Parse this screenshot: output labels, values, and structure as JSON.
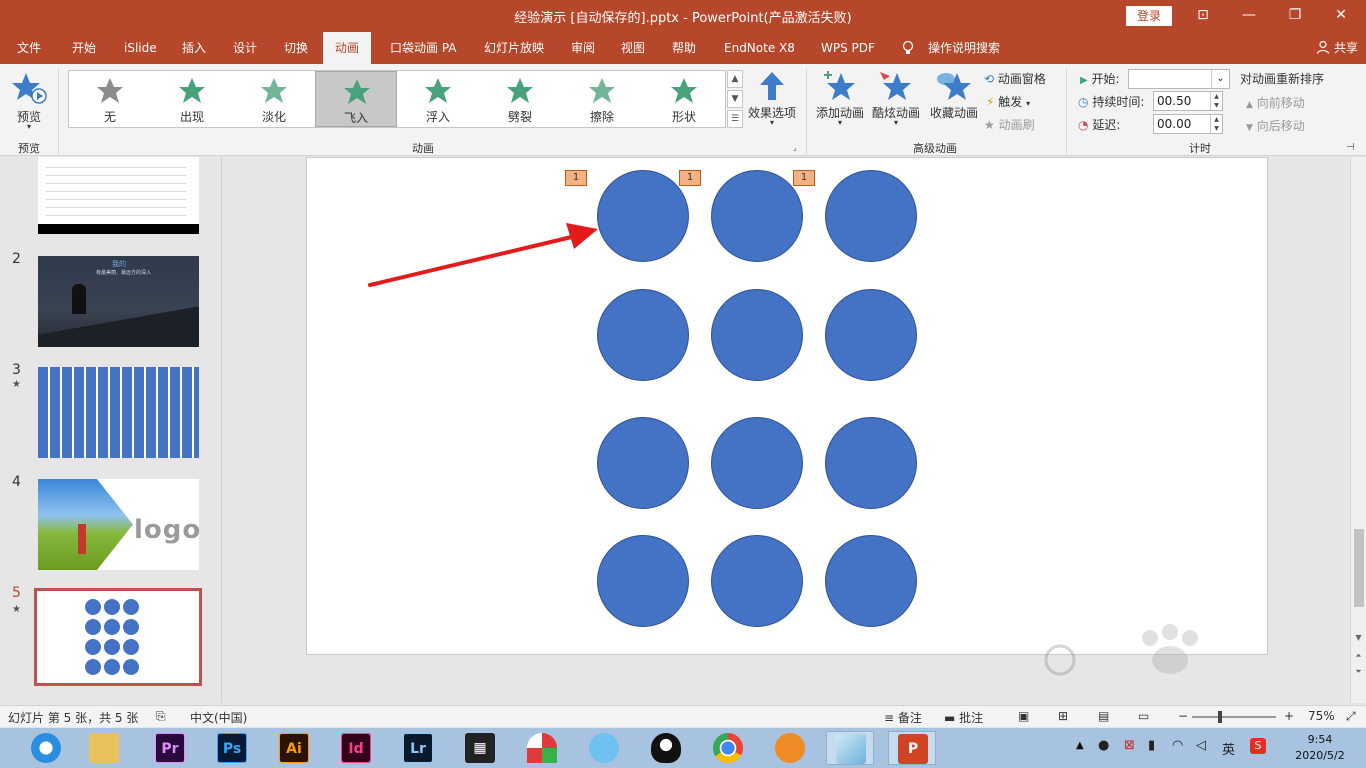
{
  "titlebar": {
    "title": "经验演示 [自动保存的].pptx  -  PowerPoint(产品激活失败)",
    "login": "登录",
    "ribbon_display_icon": "⊡",
    "minimize_icon": "—",
    "restore_icon": "❐",
    "close_icon": "✕"
  },
  "tabs": [
    "文件",
    "开始",
    "iSlide",
    "插入",
    "设计",
    "切换",
    "动画",
    "口袋动画 PA",
    "幻灯片放映",
    "审阅",
    "视图",
    "帮助",
    "EndNote X8",
    "WPS PDF",
    "操作说明搜索"
  ],
  "share": "共享",
  "ribbon": {
    "preview": {
      "label": "预览",
      "group": "预览"
    },
    "gallery": [
      {
        "label": "无",
        "color": "#8c8c8c"
      },
      {
        "label": "出现",
        "color": "#4aa27c"
      },
      {
        "label": "淡化",
        "color": "#74b59a"
      },
      {
        "label": "飞入",
        "color": "#4aa27c"
      },
      {
        "label": "浮入",
        "color": "#4aa27c"
      },
      {
        "label": "劈裂",
        "color": "#4aa27c"
      },
      {
        "label": "擦除",
        "color": "#74b59a"
      },
      {
        "label": "形状",
        "color": "#4aa27c"
      }
    ],
    "effect_options": "效果选项",
    "animation_group": "动画",
    "add_animation": "添加动画",
    "cool_animation": "酷炫动画",
    "collect_animation": "收藏动画",
    "animation_pane": "动画窗格",
    "trigger": "触发",
    "animation_painter": "动画刷",
    "advanced_group": "高级动画",
    "start_label": "开始:",
    "start_value": "",
    "duration_label": "持续时间:",
    "duration_value": "00.50",
    "delay_label": "延迟:",
    "delay_value": "00.00",
    "reorder_title": "对动画重新排序",
    "move_earlier": "向前移动",
    "move_later": "向后移动",
    "timing_group": "计时"
  },
  "thumbnails": [
    {
      "num": "",
      "star": false
    },
    {
      "num": "2",
      "star": false,
      "title": "我的",
      "subtitle": "有最美丽、最远方的深入"
    },
    {
      "num": "3",
      "star": true
    },
    {
      "num": "4",
      "star": false,
      "logo": "logo"
    },
    {
      "num": "5",
      "star": true
    }
  ],
  "slide": {
    "tags": [
      "1",
      "1",
      "1"
    ]
  },
  "status": {
    "slide_info": "幻灯片 第 5 张，共 5 张",
    "language": "中文(中国)",
    "notes": "备注",
    "comments": "批注",
    "zoom": "75%"
  },
  "taskbar": {
    "apps": [
      {
        "name": "Pr",
        "bg": "#2a0a3a",
        "fg": "#e08cff"
      },
      {
        "name": "Ps",
        "bg": "#0a1a33",
        "fg": "#33a8ff"
      },
      {
        "name": "Ai",
        "bg": "#2a1400",
        "fg": "#ff9a00"
      },
      {
        "name": "Id",
        "bg": "#33001a",
        "fg": "#ff3d8b"
      },
      {
        "name": "Lr",
        "bg": "#0a1a2a",
        "fg": "#8cc7ff"
      }
    ],
    "ime": "英",
    "time": "9:54",
    "date": "2020/5/2"
  },
  "colors": {
    "accent": "#b7472a",
    "shape_fill": "#4472c4",
    "shape_border": "#2f528f",
    "tag_fill": "#f4b183",
    "arrow": "#e31b1b"
  }
}
